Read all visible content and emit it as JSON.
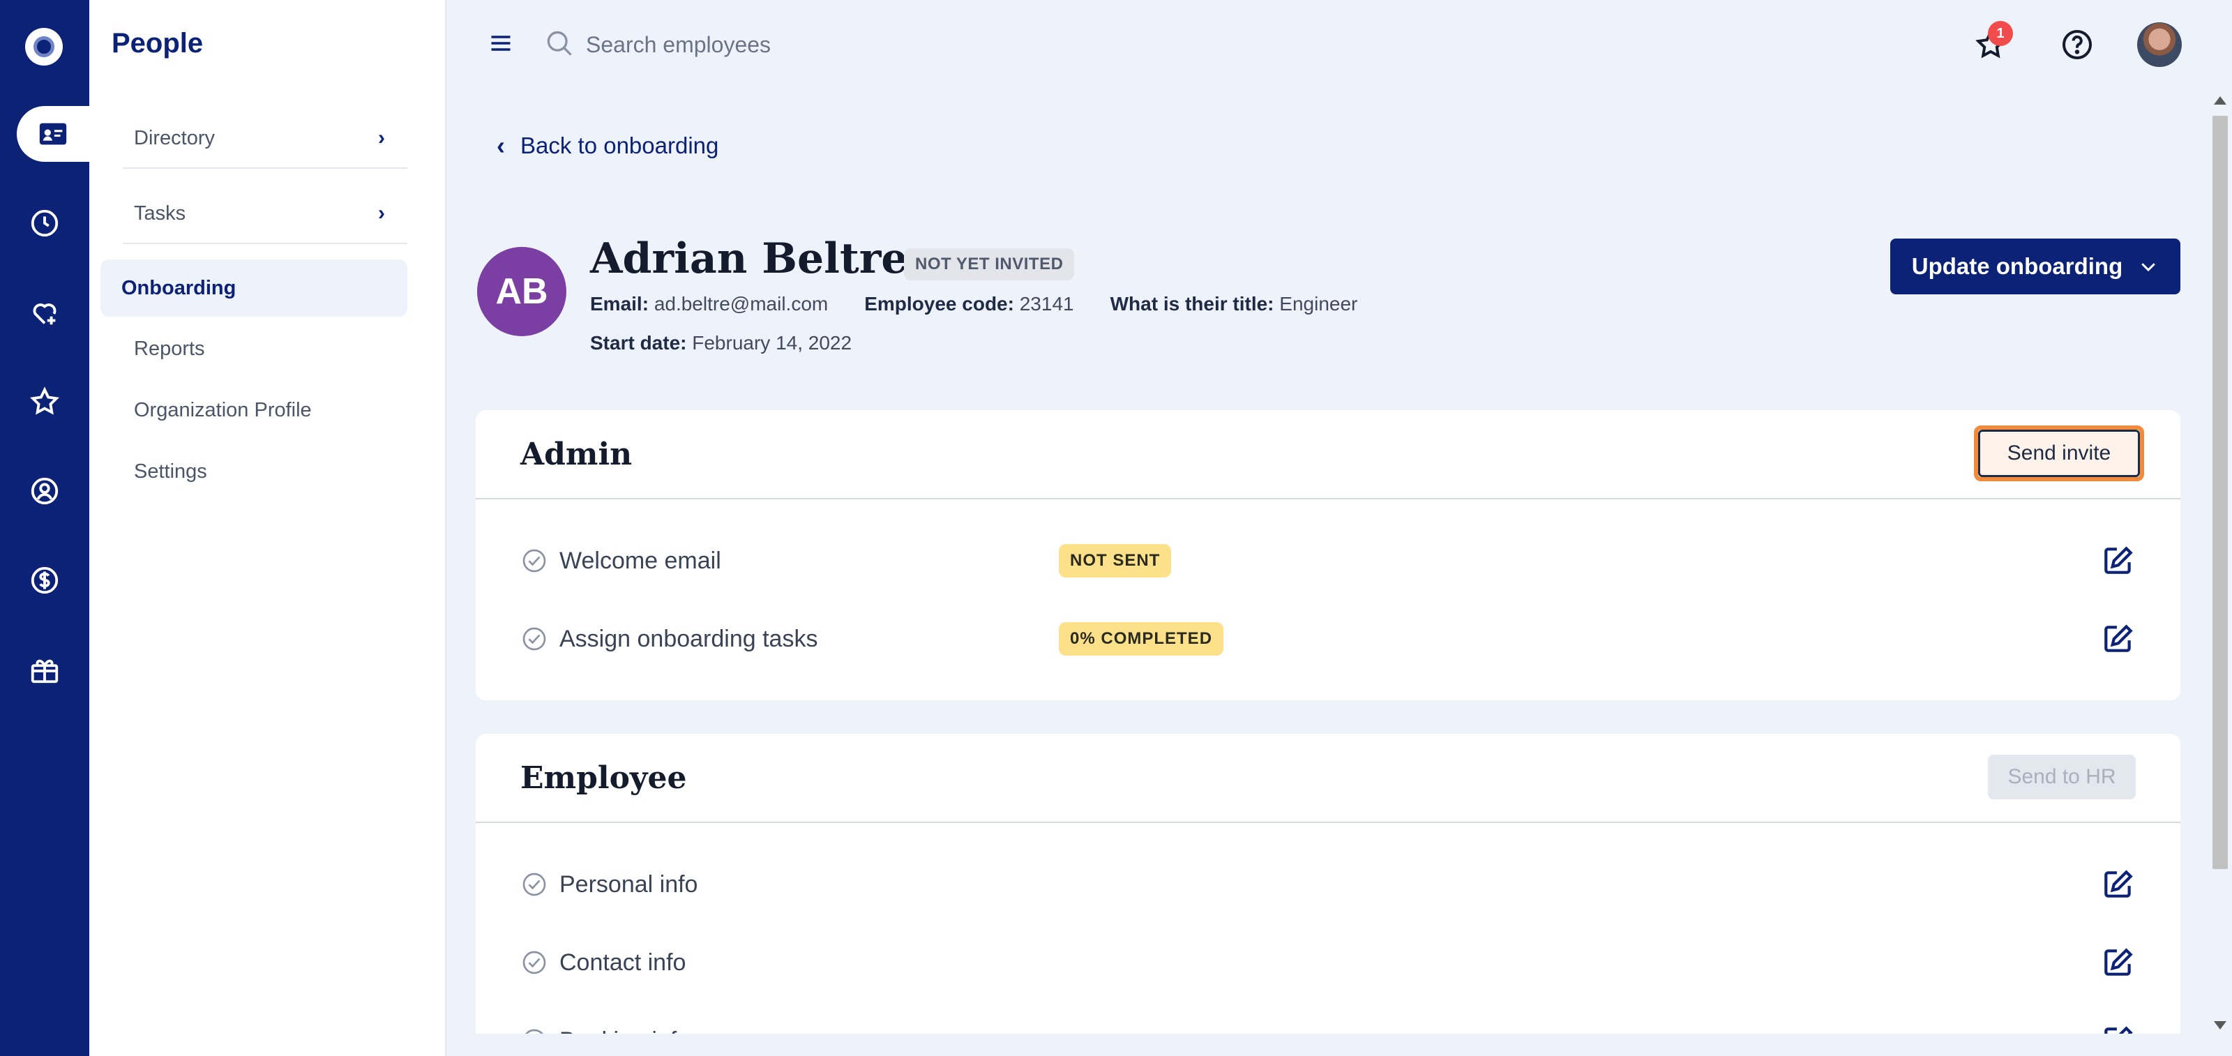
{
  "rail": {
    "icons": [
      "logo-icon",
      "people-card-icon",
      "clock-icon",
      "heart-plus-icon",
      "star-icon",
      "person-search-icon",
      "dollar-icon",
      "gift-box-icon"
    ]
  },
  "nav": {
    "title": "People",
    "items": [
      {
        "label": "Directory",
        "has_chevron": true
      },
      {
        "label": "Tasks",
        "has_chevron": true
      },
      {
        "label": "Onboarding",
        "active": true
      },
      {
        "label": "Reports"
      },
      {
        "label": "Organization Profile"
      },
      {
        "label": "Settings"
      }
    ]
  },
  "topbar": {
    "search_placeholder": "Search employees",
    "notification_count": "1"
  },
  "page": {
    "back_label": "Back to onboarding",
    "avatar_initials": "AB",
    "name": "Adrian Beltre",
    "status": "NOT YET INVITED",
    "email_label": "Email:",
    "email": "ad.beltre@mail.com",
    "code_label": "Employee code:",
    "code": "23141",
    "title_label": "What is their title:",
    "title": "Engineer",
    "start_label": "Start date:",
    "start_date": "February 14, 2022",
    "update_button": "Update onboarding"
  },
  "admin_card": {
    "title": "Admin",
    "action": "Send invite",
    "tasks": [
      {
        "label": "Welcome email",
        "badge": "NOT SENT"
      },
      {
        "label": "Assign onboarding tasks",
        "badge": "0% COMPLETED"
      }
    ]
  },
  "employee_card": {
    "title": "Employee",
    "action": "Send to HR",
    "tasks": [
      {
        "label": "Personal info"
      },
      {
        "label": "Contact info"
      },
      {
        "label": "Banking info"
      }
    ]
  },
  "colors": {
    "brand_navy": "#0b2277",
    "avatar_purple": "#7b3fa4",
    "badge_yellow": "#fde08a",
    "focus_orange": "#f08a3c",
    "notif_red": "#f04c4c"
  }
}
